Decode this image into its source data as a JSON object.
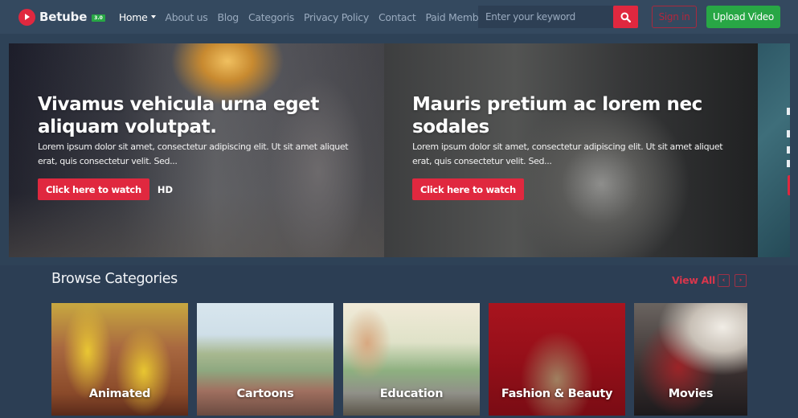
{
  "brand": {
    "name": "Betube",
    "version_badge": "3.0"
  },
  "nav": {
    "items": [
      {
        "label": "Home",
        "active": true,
        "dropdown": true
      },
      {
        "label": "About us",
        "active": false,
        "dropdown": false
      },
      {
        "label": "Blog",
        "active": false,
        "dropdown": false
      },
      {
        "label": "Categoris",
        "active": false,
        "dropdown": false
      },
      {
        "label": "Privacy Policy",
        "active": false,
        "dropdown": false
      },
      {
        "label": "Contact",
        "active": false,
        "dropdown": false
      },
      {
        "label": "Paid Membership",
        "active": false,
        "dropdown": true
      }
    ]
  },
  "search": {
    "placeholder": "Enter your keyword",
    "value": "",
    "icon": "search-icon"
  },
  "auth": {
    "signin_label": "Sign in",
    "upload_label": "Upload Video"
  },
  "slider": {
    "slides": [
      {
        "title": "Vivamus vehicula urna eget aliquam volutpat.",
        "description": "Lorem ipsum dolor sit amet, consectetur adipiscing elit. Ut sit amet aliquet erat, quis consectetur velit. Sed...",
        "button_label": "Click here to watch",
        "quality_badge": "HD"
      },
      {
        "title": "Mauris pretium ac lorem nec sodales",
        "description": "Lorem ipsum dolor sit amet, consectetur adipiscing elit. Ut sit amet aliquet erat, quis consectetur velit. Sed...",
        "button_label": "Click here to watch"
      }
    ]
  },
  "categories": {
    "title": "Browse Categories",
    "view_all_label": "View All",
    "prev_icon": "‹",
    "next_icon": "›",
    "items": [
      {
        "label": "Animated"
      },
      {
        "label": "Cartoons"
      },
      {
        "label": "Education"
      },
      {
        "label": "Fashion & Beauty"
      },
      {
        "label": "Movies"
      }
    ]
  },
  "colors": {
    "accent": "#e0283f",
    "success": "#28a745",
    "navbar": "#34495f",
    "background": "#2c3e54"
  }
}
